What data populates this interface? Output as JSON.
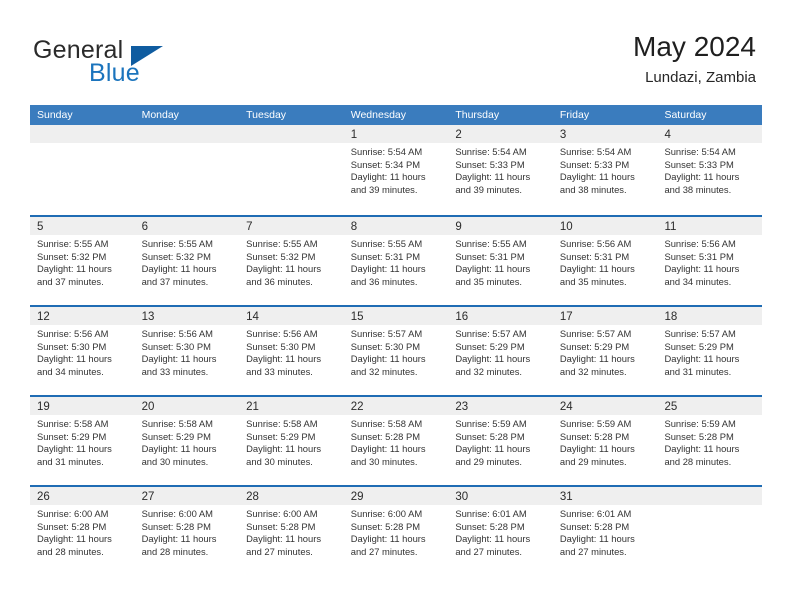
{
  "brand": {
    "name_part1": "General",
    "name_part2": "Blue",
    "accent_color": "#1b74bd",
    "triangle_color": "#0f5ca0"
  },
  "header": {
    "title": "May 2024",
    "subtitle": "Lundazi, Zambia"
  },
  "calendar": {
    "header_bg": "#3a7cbe",
    "row_divider_color": "#1f6cb4",
    "day_band_bg": "#efefef",
    "weekdays": [
      "Sunday",
      "Monday",
      "Tuesday",
      "Wednesday",
      "Thursday",
      "Friday",
      "Saturday"
    ],
    "weeks": [
      [
        {
          "day": "",
          "lines": []
        },
        {
          "day": "",
          "lines": []
        },
        {
          "day": "",
          "lines": []
        },
        {
          "day": "1",
          "lines": [
            "Sunrise: 5:54 AM",
            "Sunset: 5:34 PM",
            "Daylight: 11 hours",
            "and 39 minutes."
          ]
        },
        {
          "day": "2",
          "lines": [
            "Sunrise: 5:54 AM",
            "Sunset: 5:33 PM",
            "Daylight: 11 hours",
            "and 39 minutes."
          ]
        },
        {
          "day": "3",
          "lines": [
            "Sunrise: 5:54 AM",
            "Sunset: 5:33 PM",
            "Daylight: 11 hours",
            "and 38 minutes."
          ]
        },
        {
          "day": "4",
          "lines": [
            "Sunrise: 5:54 AM",
            "Sunset: 5:33 PM",
            "Daylight: 11 hours",
            "and 38 minutes."
          ]
        }
      ],
      [
        {
          "day": "5",
          "lines": [
            "Sunrise: 5:55 AM",
            "Sunset: 5:32 PM",
            "Daylight: 11 hours",
            "and 37 minutes."
          ]
        },
        {
          "day": "6",
          "lines": [
            "Sunrise: 5:55 AM",
            "Sunset: 5:32 PM",
            "Daylight: 11 hours",
            "and 37 minutes."
          ]
        },
        {
          "day": "7",
          "lines": [
            "Sunrise: 5:55 AM",
            "Sunset: 5:32 PM",
            "Daylight: 11 hours",
            "and 36 minutes."
          ]
        },
        {
          "day": "8",
          "lines": [
            "Sunrise: 5:55 AM",
            "Sunset: 5:31 PM",
            "Daylight: 11 hours",
            "and 36 minutes."
          ]
        },
        {
          "day": "9",
          "lines": [
            "Sunrise: 5:55 AM",
            "Sunset: 5:31 PM",
            "Daylight: 11 hours",
            "and 35 minutes."
          ]
        },
        {
          "day": "10",
          "lines": [
            "Sunrise: 5:56 AM",
            "Sunset: 5:31 PM",
            "Daylight: 11 hours",
            "and 35 minutes."
          ]
        },
        {
          "day": "11",
          "lines": [
            "Sunrise: 5:56 AM",
            "Sunset: 5:31 PM",
            "Daylight: 11 hours",
            "and 34 minutes."
          ]
        }
      ],
      [
        {
          "day": "12",
          "lines": [
            "Sunrise: 5:56 AM",
            "Sunset: 5:30 PM",
            "Daylight: 11 hours",
            "and 34 minutes."
          ]
        },
        {
          "day": "13",
          "lines": [
            "Sunrise: 5:56 AM",
            "Sunset: 5:30 PM",
            "Daylight: 11 hours",
            "and 33 minutes."
          ]
        },
        {
          "day": "14",
          "lines": [
            "Sunrise: 5:56 AM",
            "Sunset: 5:30 PM",
            "Daylight: 11 hours",
            "and 33 minutes."
          ]
        },
        {
          "day": "15",
          "lines": [
            "Sunrise: 5:57 AM",
            "Sunset: 5:30 PM",
            "Daylight: 11 hours",
            "and 32 minutes."
          ]
        },
        {
          "day": "16",
          "lines": [
            "Sunrise: 5:57 AM",
            "Sunset: 5:29 PM",
            "Daylight: 11 hours",
            "and 32 minutes."
          ]
        },
        {
          "day": "17",
          "lines": [
            "Sunrise: 5:57 AM",
            "Sunset: 5:29 PM",
            "Daylight: 11 hours",
            "and 32 minutes."
          ]
        },
        {
          "day": "18",
          "lines": [
            "Sunrise: 5:57 AM",
            "Sunset: 5:29 PM",
            "Daylight: 11 hours",
            "and 31 minutes."
          ]
        }
      ],
      [
        {
          "day": "19",
          "lines": [
            "Sunrise: 5:58 AM",
            "Sunset: 5:29 PM",
            "Daylight: 11 hours",
            "and 31 minutes."
          ]
        },
        {
          "day": "20",
          "lines": [
            "Sunrise: 5:58 AM",
            "Sunset: 5:29 PM",
            "Daylight: 11 hours",
            "and 30 minutes."
          ]
        },
        {
          "day": "21",
          "lines": [
            "Sunrise: 5:58 AM",
            "Sunset: 5:29 PM",
            "Daylight: 11 hours",
            "and 30 minutes."
          ]
        },
        {
          "day": "22",
          "lines": [
            "Sunrise: 5:58 AM",
            "Sunset: 5:28 PM",
            "Daylight: 11 hours",
            "and 30 minutes."
          ]
        },
        {
          "day": "23",
          "lines": [
            "Sunrise: 5:59 AM",
            "Sunset: 5:28 PM",
            "Daylight: 11 hours",
            "and 29 minutes."
          ]
        },
        {
          "day": "24",
          "lines": [
            "Sunrise: 5:59 AM",
            "Sunset: 5:28 PM",
            "Daylight: 11 hours",
            "and 29 minutes."
          ]
        },
        {
          "day": "25",
          "lines": [
            "Sunrise: 5:59 AM",
            "Sunset: 5:28 PM",
            "Daylight: 11 hours",
            "and 28 minutes."
          ]
        }
      ],
      [
        {
          "day": "26",
          "lines": [
            "Sunrise: 6:00 AM",
            "Sunset: 5:28 PM",
            "Daylight: 11 hours",
            "and 28 minutes."
          ]
        },
        {
          "day": "27",
          "lines": [
            "Sunrise: 6:00 AM",
            "Sunset: 5:28 PM",
            "Daylight: 11 hours",
            "and 28 minutes."
          ]
        },
        {
          "day": "28",
          "lines": [
            "Sunrise: 6:00 AM",
            "Sunset: 5:28 PM",
            "Daylight: 11 hours",
            "and 27 minutes."
          ]
        },
        {
          "day": "29",
          "lines": [
            "Sunrise: 6:00 AM",
            "Sunset: 5:28 PM",
            "Daylight: 11 hours",
            "and 27 minutes."
          ]
        },
        {
          "day": "30",
          "lines": [
            "Sunrise: 6:01 AM",
            "Sunset: 5:28 PM",
            "Daylight: 11 hours",
            "and 27 minutes."
          ]
        },
        {
          "day": "31",
          "lines": [
            "Sunrise: 6:01 AM",
            "Sunset: 5:28 PM",
            "Daylight: 11 hours",
            "and 27 minutes."
          ]
        },
        {
          "day": "",
          "lines": []
        }
      ]
    ]
  }
}
